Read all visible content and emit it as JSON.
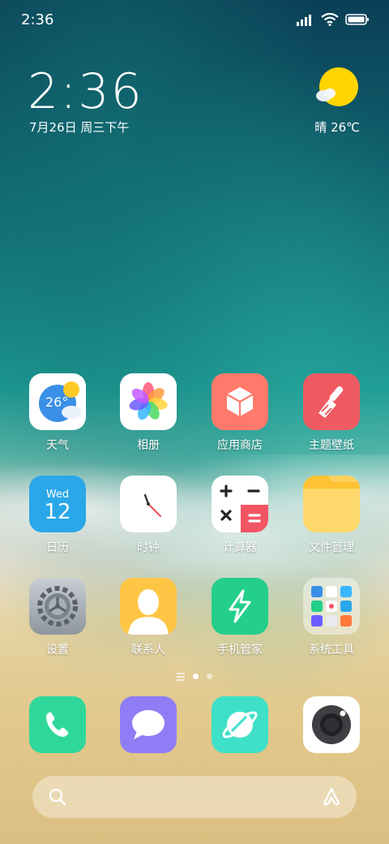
{
  "status": {
    "time": "2:36"
  },
  "clock": {
    "time": "2:36",
    "date": "7月26日 周三下午"
  },
  "weather": {
    "text": "晴 26℃"
  },
  "apps": [
    {
      "label": "天气",
      "icon": "weather-icon",
      "badge": "26°"
    },
    {
      "label": "相册",
      "icon": "gallery-icon"
    },
    {
      "label": "应用商店",
      "icon": "app-store-icon"
    },
    {
      "label": "主题壁纸",
      "icon": "themes-icon"
    },
    {
      "label": "日历",
      "icon": "calendar-icon",
      "day": "Wed",
      "date": "12"
    },
    {
      "label": "时钟",
      "icon": "clock-icon"
    },
    {
      "label": "计算器",
      "icon": "calculator-icon"
    },
    {
      "label": "文件管理",
      "icon": "folder-icon"
    },
    {
      "label": "设置",
      "icon": "settings-icon"
    },
    {
      "label": "联系人",
      "icon": "contacts-icon"
    },
    {
      "label": "手机管家",
      "icon": "security-icon"
    },
    {
      "label": "系统工具",
      "icon": "system-tools-folder-icon"
    }
  ],
  "dock": [
    {
      "name": "phone",
      "icon": "phone-icon",
      "color": "#2fd89a"
    },
    {
      "name": "messages",
      "icon": "message-icon",
      "color": "#8f7df5"
    },
    {
      "name": "browser",
      "icon": "browser-icon",
      "color": "#3fe0c8"
    },
    {
      "name": "camera",
      "icon": "camera-icon",
      "color": "#ffffff"
    }
  ],
  "colors": {
    "weather_bg": "#ffffff",
    "appstore": "#ff7a6b",
    "themes": "#f05a62",
    "calendar": "#2aa7e8",
    "calculator_accent": "#f25564",
    "folder": "#ffd15c",
    "security": "#23cf8a",
    "contacts": "#ffc545"
  }
}
